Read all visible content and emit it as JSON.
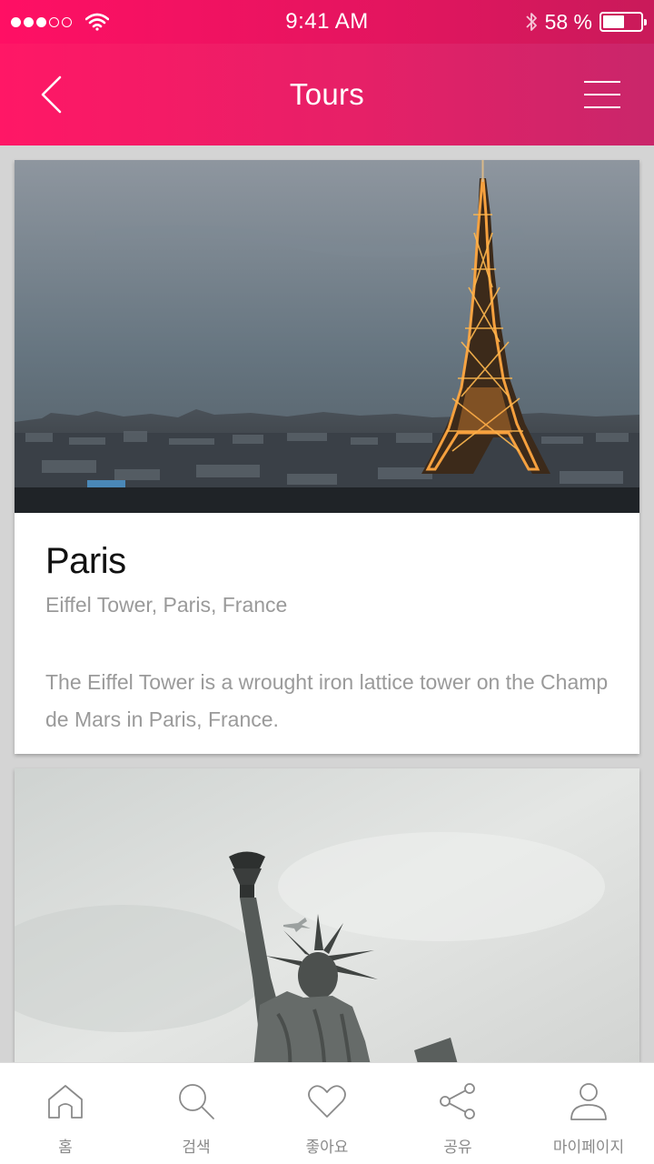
{
  "status_bar": {
    "time": "9:41 AM",
    "battery_text": "58 %",
    "battery_level": 0.58,
    "signal_filled": 3,
    "signal_total": 5,
    "icons": [
      "signal-dots",
      "wifi-icon",
      "bluetooth-icon",
      "battery-icon"
    ]
  },
  "nav": {
    "title": "Tours",
    "back_icon": "chevron-left-icon",
    "menu_icon": "hamburger-menu-icon"
  },
  "theme": {
    "accent": "#ff1766",
    "accent_end": "#c9266a",
    "text_primary": "#111111",
    "text_secondary": "#9a9a9a",
    "background": "#d4d4d4"
  },
  "tours": [
    {
      "title": "Paris",
      "subtitle": "Eiffel Tower, Paris, France",
      "description": "The Eiffel Tower is a wrought iron lattice tower on the Champ de Mars in Paris, France.",
      "image": "eiffel-tower-photo"
    },
    {
      "image": "statue-of-liberty-photo"
    }
  ],
  "tab_bar": {
    "items": [
      {
        "label": "홈",
        "icon": "home-icon"
      },
      {
        "label": "검색",
        "icon": "search-icon"
      },
      {
        "label": "좋아요",
        "icon": "heart-icon"
      },
      {
        "label": "공유",
        "icon": "share-icon"
      },
      {
        "label": "마이페이지",
        "icon": "profile-icon"
      }
    ]
  }
}
